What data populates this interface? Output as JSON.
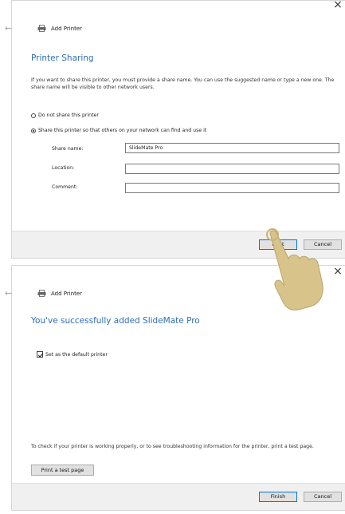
{
  "panel1": {
    "close_glyph": "×",
    "window_title": "Add Printer",
    "heading": "Printer Sharing",
    "description": "If you want to share this printer, you must provide a share name. You can use the suggested name or type a new one. The share name will be visible to other network users.",
    "radio_no_share": "Do not share this printer",
    "radio_share": "Share this printer so that others on your network can find and use it",
    "share_name_label": "Share name:",
    "share_name_value": "SlideMate Pro",
    "location_label": "Location:",
    "location_value": "",
    "comment_label": "Comment:",
    "comment_value": "",
    "next_button": "Next",
    "cancel_button": "Cancel"
  },
  "panel2": {
    "close_glyph": "×",
    "window_title": "Add Printer",
    "heading": "You've successfully added SlideMate Pro",
    "default_printer_label": "Set as the default printer",
    "default_printer_checked": true,
    "test_info": "To check if your printer is working properly, or to see troubleshooting information for the printer, print a test page.",
    "print_test_button": "Print a test page",
    "finish_button": "Finish",
    "cancel_button": "Cancel"
  },
  "colors": {
    "accent_blue": "#2e6db5",
    "focus_border": "#0078d7",
    "hand": "#d8c48a"
  }
}
